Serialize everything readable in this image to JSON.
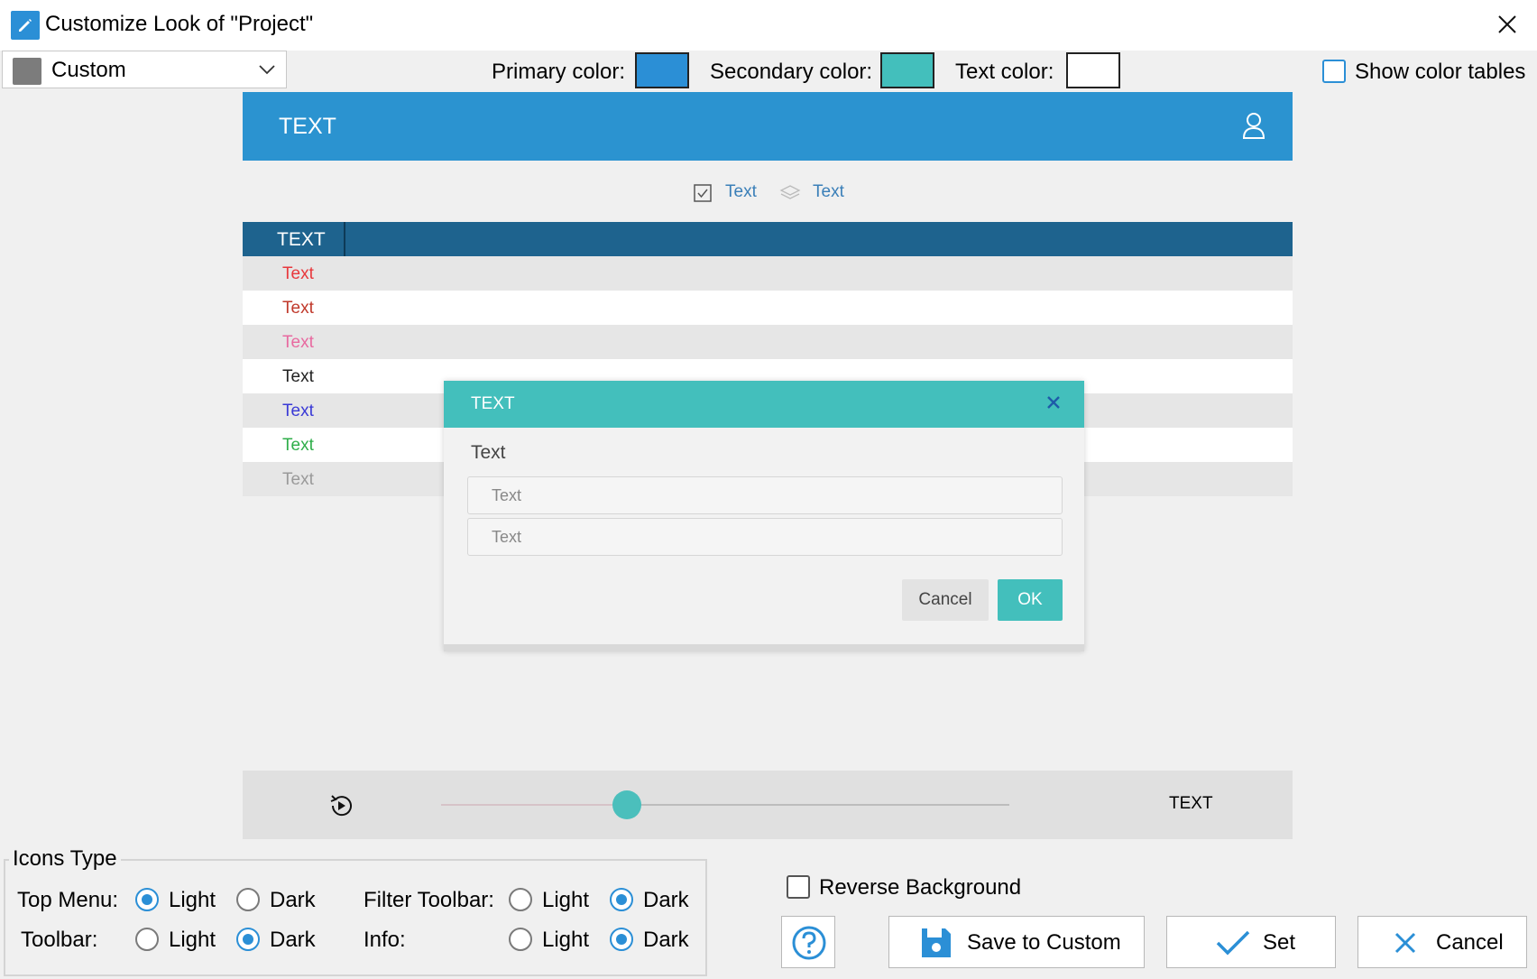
{
  "window": {
    "title": "Customize Look of \"Project\""
  },
  "preset": {
    "selected": "Custom",
    "swatch_color": "#7c7c7c"
  },
  "colors": {
    "primary_label": "Primary color:",
    "primary": "#2b8fd6",
    "secondary_label": "Secondary color:",
    "secondary": "#43bfbc",
    "text_label": "Text color:",
    "text": "#ffffff"
  },
  "show_color_tables": {
    "label": "Show color tables",
    "checked": false
  },
  "preview": {
    "header_text": "TEXT",
    "toolbar": [
      "Text",
      "Text"
    ],
    "table_header": "TEXT",
    "rows": [
      {
        "text": "Text",
        "color": "#e8383d"
      },
      {
        "text": "Text",
        "color": "#c0392b"
      },
      {
        "text": "Text",
        "color": "#e86aa0"
      },
      {
        "text": "Text",
        "color": "#222222"
      },
      {
        "text": "Text",
        "color": "#3a3ad6"
      },
      {
        "text": "Text",
        "color": "#2fae4a"
      },
      {
        "text": "Text",
        "color": "#9a9a9a"
      }
    ],
    "dialog": {
      "title": "TEXT",
      "label": "Text",
      "input1_placeholder": "Text",
      "input2_placeholder": "Text",
      "cancel": "Cancel",
      "ok": "OK"
    },
    "player_text": "TEXT"
  },
  "icons_type": {
    "title": "Icons Type",
    "top_menu": {
      "label": "Top Menu:",
      "light": "Light",
      "dark": "Dark",
      "selected": "Light"
    },
    "toolbar": {
      "label": "Toolbar:",
      "light": "Light",
      "dark": "Dark",
      "selected": "Dark"
    },
    "filter_toolbar": {
      "label": "Filter Toolbar:",
      "light": "Light",
      "dark": "Dark",
      "selected": "Dark"
    },
    "info": {
      "label": "Info:",
      "light": "Light",
      "dark": "Dark",
      "selected": "Dark"
    }
  },
  "reverse_background": {
    "label": "Reverse Background",
    "checked": false
  },
  "buttons": {
    "save": "Save to Custom",
    "set": "Set",
    "cancel": "Cancel"
  }
}
